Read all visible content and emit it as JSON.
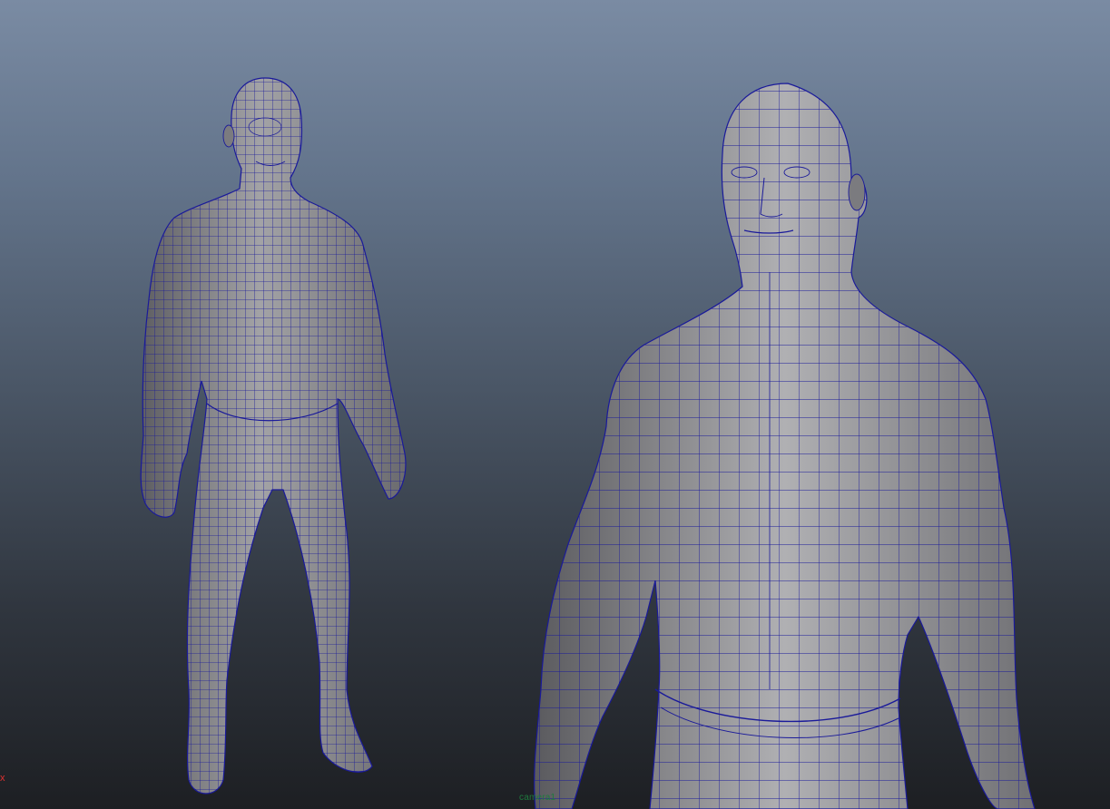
{
  "viewport": {
    "background_top": "#7a8ba3",
    "background_bottom": "#1d1f23",
    "mesh_fill": "#8c8c8f",
    "wire_color": "#1a1a9a",
    "axis_x_label": "x",
    "camera_label": "camera1"
  },
  "objects": [
    {
      "name": "full-body-model"
    },
    {
      "name": "upper-body-closeup-model"
    }
  ]
}
